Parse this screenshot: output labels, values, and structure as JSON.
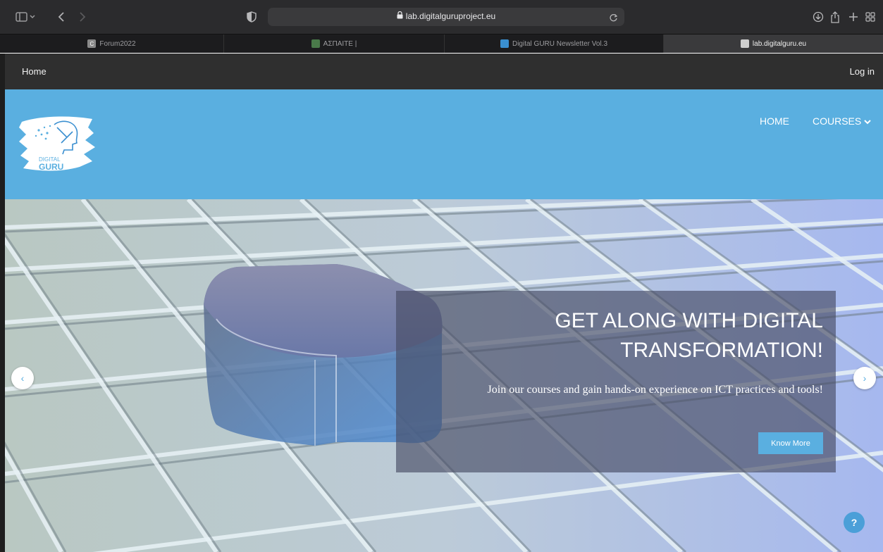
{
  "browser": {
    "url": "lab.digitalguruproject.eu",
    "tabs": [
      {
        "label": "Forum2022",
        "favicon_color": "#8a8a8a",
        "favicon_letter": "C"
      },
      {
        "label": "ΑΣΠΑΙΤΕ |",
        "favicon_color": "#4a7a4a"
      },
      {
        "label": "Digital GURU Newsletter Vol.3",
        "favicon_color": "#3a8fd0"
      },
      {
        "label": "lab.digitalguru.eu",
        "favicon_color": "#cfcfcf",
        "active": true
      }
    ]
  },
  "navbar": {
    "home_label": "Home",
    "login_label": "Log in"
  },
  "header": {
    "logo_text_line1": "DIGITAL",
    "logo_text_line2": "GURU",
    "menu": [
      {
        "label": "HOME"
      },
      {
        "label": "COURSES",
        "has_dropdown": true
      }
    ],
    "bg_color": "#5aafe0"
  },
  "hero": {
    "title": "GET ALONG WITH DIGITAL TRANSFORMATION!",
    "subtitle": "Join our courses and gain hands-on experience on ICT practices and tools!",
    "button_label": "Know More",
    "prev_label": "‹",
    "next_label": "›"
  },
  "help": {
    "label": "?"
  }
}
